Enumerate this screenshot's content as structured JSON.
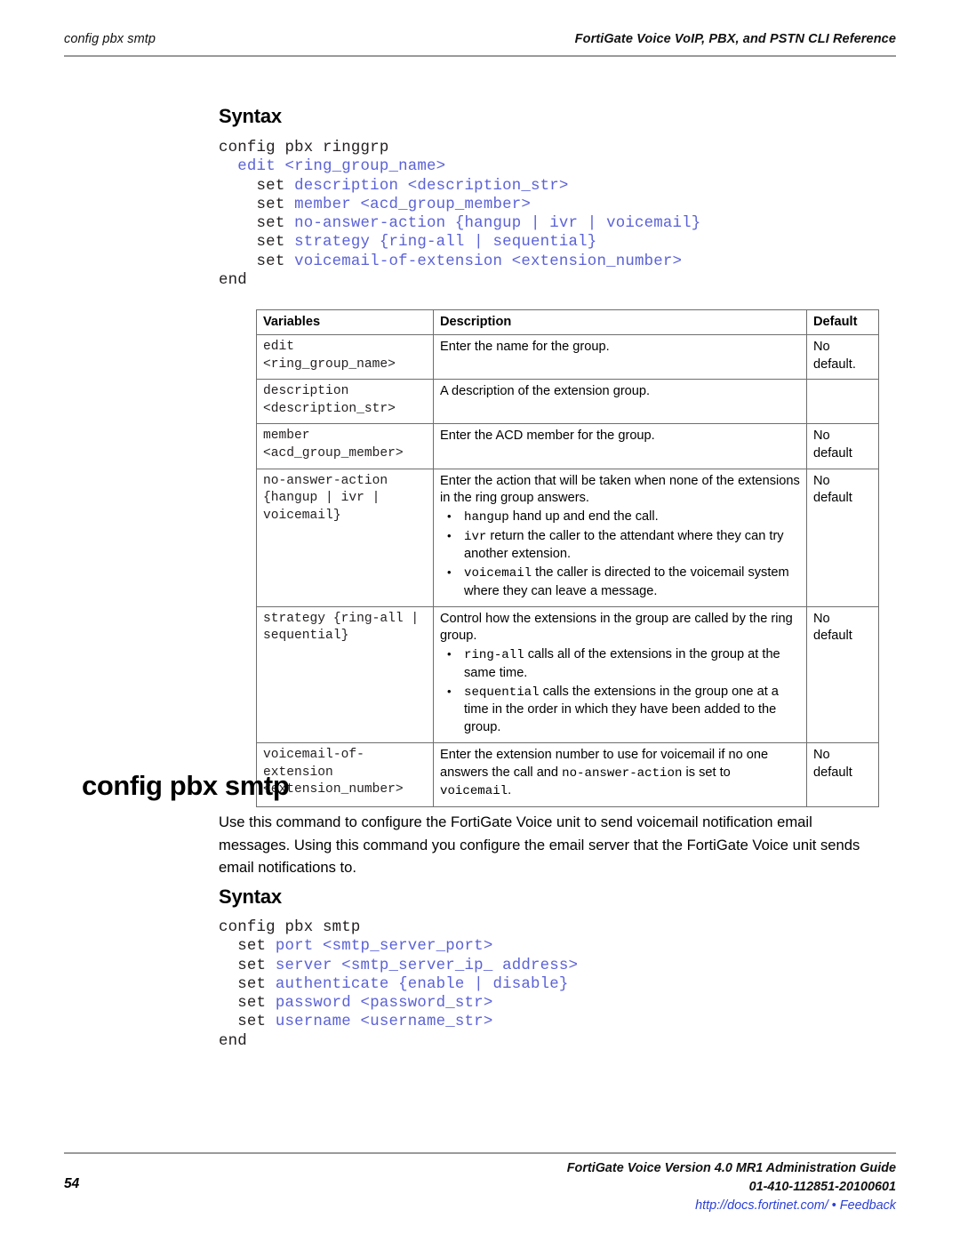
{
  "header": {
    "left": "config pbx smtp",
    "right": "FortiGate Voice VoIP, PBX, and PSTN CLI Reference"
  },
  "section_one": {
    "syntax_heading": "Syntax",
    "code_lines": [
      [
        {
          "t": "config pbx ringgrp",
          "k": false
        }
      ],
      [
        {
          "t": "  ",
          "k": false
        },
        {
          "t": "edit <ring_group_name>",
          "k": true
        }
      ],
      [
        {
          "t": "    set ",
          "k": false
        },
        {
          "t": "description <description_str>",
          "k": true
        }
      ],
      [
        {
          "t": "    set ",
          "k": false
        },
        {
          "t": "member <acd_group_member>",
          "k": true
        }
      ],
      [
        {
          "t": "    set ",
          "k": false
        },
        {
          "t": "no-answer-action {hangup | ivr | voicemail}",
          "k": true
        }
      ],
      [
        {
          "t": "    set ",
          "k": false
        },
        {
          "t": "strategy {ring-all | sequential}",
          "k": true
        }
      ],
      [
        {
          "t": "    set ",
          "k": false
        },
        {
          "t": "voicemail-of-extension <extension_number>",
          "k": true
        }
      ],
      [
        {
          "t": "end",
          "k": false
        }
      ]
    ]
  },
  "table": {
    "headers": [
      "Variables",
      "Description",
      "Default"
    ],
    "rows": [
      {
        "variable": "edit\n<ring_group_name>",
        "description": "Enter the name for the group.",
        "bullets": [],
        "default": "No\ndefault."
      },
      {
        "variable": "description\n<description_str>",
        "description": "A description of the extension group.",
        "bullets": [],
        "default": ""
      },
      {
        "variable": "member\n<acd_group_member>",
        "description": "Enter the ACD member for the group.",
        "bullets": [],
        "default": "No\ndefault"
      },
      {
        "variable": "no-answer-action\n{hangup | ivr |\nvoicemail}",
        "description": "Enter the action that will be taken when none of the extensions in the ring group answers.",
        "bullets": [
          {
            "code": "hangup",
            "text": " hand up and end the call."
          },
          {
            "code": "ivr",
            "text": " return the caller to the attendant where they can try another extension."
          },
          {
            "code": "voicemail",
            "text": " the caller is directed to the voicemail system where they can leave a message."
          }
        ],
        "default": "No\ndefault"
      },
      {
        "variable": "strategy {ring-all |\nsequential}",
        "description": "Control how the extensions in the group are called by the ring group.",
        "bullets": [
          {
            "code": "ring-all",
            "text": " calls all of the extensions in the group at the same time."
          },
          {
            "code": "sequential",
            "text": " calls the extensions in the group one at a time in the order in which they have been added to the group."
          }
        ],
        "default": "No\ndefault"
      },
      {
        "variable": "voicemail-of-\nextension\n<extension_number>",
        "description_parts": [
          {
            "code": false,
            "text": "Enter the extension number to use for voicemail if no one answers the call and "
          },
          {
            "code": true,
            "text": "no-answer-action"
          },
          {
            "code": false,
            "text": " is set to "
          },
          {
            "code": true,
            "text": "voicemail"
          },
          {
            "code": false,
            "text": "."
          }
        ],
        "bullets": [],
        "default": "No\ndefault"
      }
    ]
  },
  "section_two": {
    "command_heading": "config pbx smtp",
    "intro": "Use this command to configure the FortiGate Voice unit to send voicemail notification email messages. Using this command you configure the email server that the FortiGate Voice unit sends email notifications to.",
    "syntax_heading": "Syntax",
    "code_lines": [
      [
        {
          "t": "config pbx smtp",
          "k": false
        }
      ],
      [
        {
          "t": "  set ",
          "k": false
        },
        {
          "t": "port <smtp_server_port>",
          "k": true
        }
      ],
      [
        {
          "t": "  set ",
          "k": false
        },
        {
          "t": "server <smtp_server_ip_ address>",
          "k": true
        }
      ],
      [
        {
          "t": "  set ",
          "k": false
        },
        {
          "t": "authenticate {enable | disable}",
          "k": true
        }
      ],
      [
        {
          "t": "  set ",
          "k": false
        },
        {
          "t": "password <password_str>",
          "k": true
        }
      ],
      [
        {
          "t": "  set ",
          "k": false
        },
        {
          "t": "username <username_str>",
          "k": true
        }
      ],
      [
        {
          "t": "end",
          "k": false
        }
      ]
    ]
  },
  "footer": {
    "page_number": "54",
    "guide_title": "FortiGate Voice Version 4.0 MR1 Administration Guide",
    "doc_id": "01-410-112851-20100601",
    "url_text": "http://docs.fortinet.com/",
    "separator": " • ",
    "feedback_text": "Feedback",
    "link_color": "#2b3fd6"
  }
}
